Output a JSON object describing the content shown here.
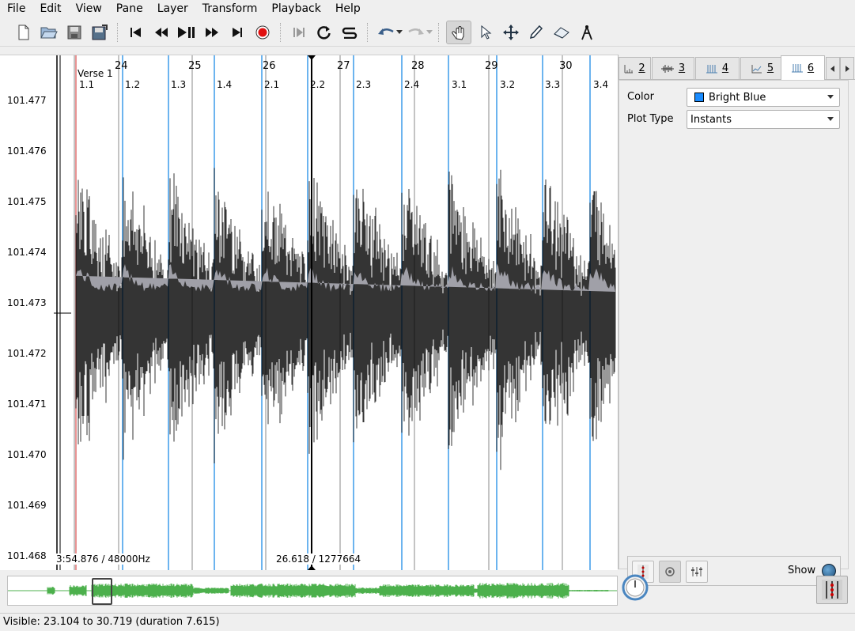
{
  "menu": [
    "File",
    "Edit",
    "View",
    "Pane",
    "Layer",
    "Transform",
    "Playback",
    "Help"
  ],
  "toolbar": {
    "icons": [
      "new-file-icon",
      "open-folder-icon",
      "save-icon",
      "save-as-icon",
      "rewind-start-icon",
      "rewind-icon",
      "play-pause-icon",
      "fast-forward-icon",
      "skip-end-icon",
      "record-icon",
      "constrain-playback-icon",
      "loop-icon",
      "solo-icon",
      "undo-icon",
      "redo-icon",
      "navigate-tool-icon",
      "select-tool-icon",
      "move-tool-icon",
      "draw-tool-icon",
      "erase-tool-icon",
      "measure-tool-icon"
    ]
  },
  "pane": {
    "scale_labels": [
      "101.477",
      "101.476",
      "101.475",
      "101.474",
      "101.473",
      "101.472",
      "101.471",
      "101.470",
      "101.469",
      "101.468"
    ],
    "bar_labels": [
      "24",
      "25",
      "26",
      "27",
      "28",
      "29",
      "30"
    ],
    "beat_labels": [
      "1.1",
      "1.2",
      "1.3",
      "1.4",
      "2.1",
      "2.2",
      "2.3",
      "2.4",
      "3.1",
      "3.2",
      "3.3",
      "3.4"
    ],
    "verse_label": "Verse 1",
    "status_left": "3:54.876 / 48000Hz",
    "status_mid": "26.618 / 1277664",
    "colors": {
      "instant_lines": "#3b9bea",
      "waveform_fill": "#a0a0a8",
      "waveform_peak": "#000000",
      "playhead": "#000000"
    }
  },
  "right_panel": {
    "tabs": [
      {
        "num": "2",
        "icon": "time-ruler-icon"
      },
      {
        "num": "3",
        "icon": "waveform-icon"
      },
      {
        "num": "4",
        "icon": "time-instants-icon"
      },
      {
        "num": "5",
        "icon": "time-values-icon"
      },
      {
        "num": "6",
        "icon": "time-instants-icon"
      }
    ],
    "properties": {
      "color_label": "Color",
      "color_value": "Bright Blue",
      "plot_type_label": "Plot Type",
      "plot_type_value": "Instants"
    },
    "show_label": "Show"
  },
  "statusbar": {
    "visible_text": "Visible: 23.104 to 30.719 (duration 7.615)"
  }
}
